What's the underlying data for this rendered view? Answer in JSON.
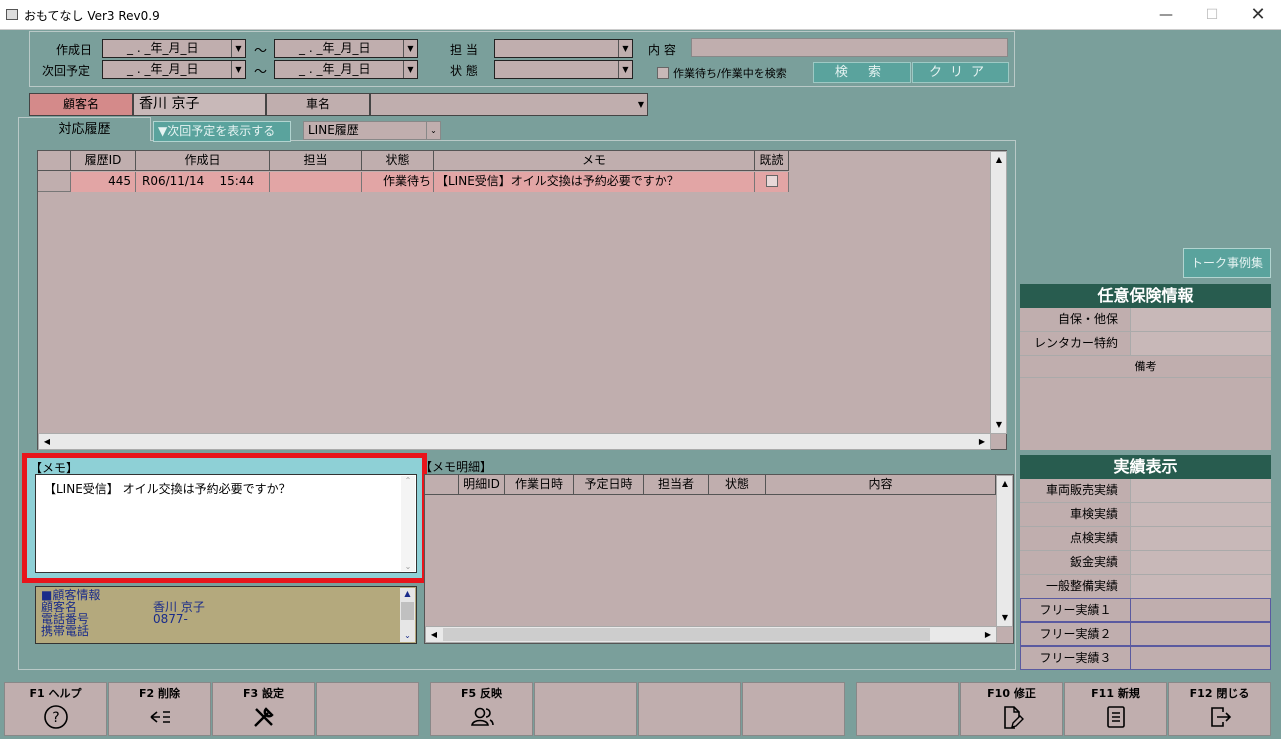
{
  "window": {
    "title": "おもてなし Ver3 Rev0.9"
  },
  "search": {
    "created_label": "作成日",
    "next_label": "次回予定",
    "date_placeholder": "_ . _年_月_日",
    "tilde": "〜",
    "staff_label": "担 当",
    "status_label": "状 態",
    "content_label": "内 容",
    "pending_checkbox_label": "作業待ち/作業中を検索",
    "search_button": "検 索",
    "clear_button": "クリア"
  },
  "customer": {
    "name_label": "顧客名",
    "name_value": "香川 京子",
    "car_label": "車名"
  },
  "tabs": {
    "history_tab": "対応履歴",
    "show_next_button": "▼次回予定を表示する",
    "line_history_select": "LINE履歴"
  },
  "history_grid": {
    "headers": [
      "履歴ID",
      "作成日",
      "担当",
      "状態",
      "メモ",
      "既読"
    ],
    "rows": [
      {
        "id": "445",
        "date": "R06/11/14",
        "time": "15:44",
        "staff": "",
        "status": "作業待ち",
        "memo": "【LINE受信】オイル交換は予約必要ですか？"
      }
    ]
  },
  "memo": {
    "title": "【メモ】",
    "text": "【LINE受信】 オイル交換は予約必要ですか？"
  },
  "customer_info": {
    "heading": "■顧客情報",
    "name_label": "顧客名",
    "name_value": "香川 京子",
    "phone_label": "電話番号",
    "phone_value": "0877-",
    "mobile_label": "携帯電話"
  },
  "memo_detail": {
    "title": "【メモ明細】",
    "headers": [
      "明細ID",
      "作業日時",
      "予定日時",
      "担当者",
      "状態",
      "内容"
    ]
  },
  "right_panel": {
    "talk_button": "トーク事例集",
    "insurance_title": "任意保険情報",
    "insurance_rows": [
      "自保・他保",
      "レンタカー特約"
    ],
    "remarks_label": "備考",
    "results_title": "実績表示",
    "results_rows": [
      "車両販売実績",
      "車検実績",
      "点検実績",
      "鈑金実績",
      "一般整備実績"
    ],
    "free_rows": [
      "フリー実績１",
      "フリー実績２",
      "フリー実績３"
    ]
  },
  "fkeys": {
    "f1": "F1 ヘルプ",
    "f2": "F2 削除",
    "f3": "F3 設定",
    "f5": "F5 反映",
    "f10": "F10 修正",
    "f11": "F11 新規",
    "f12": "F12 閉じる"
  }
}
